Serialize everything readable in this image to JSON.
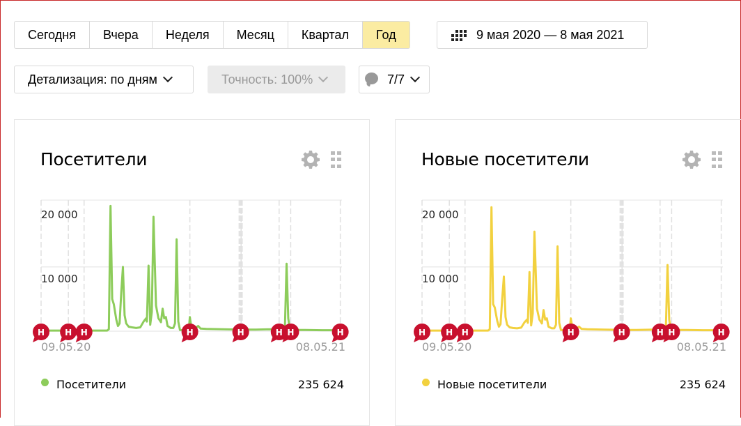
{
  "periods": [
    {
      "label": "Сегодня",
      "active": false
    },
    {
      "label": "Вчера",
      "active": false
    },
    {
      "label": "Неделя",
      "active": false
    },
    {
      "label": "Месяц",
      "active": false
    },
    {
      "label": "Квартал",
      "active": false
    },
    {
      "label": "Год",
      "active": true
    }
  ],
  "date_range": {
    "icon": "calendar-icon",
    "label": "9 мая 2020 — 8 мая 2021"
  },
  "controls": {
    "detail": "Детализация: по дням",
    "accuracy": "Точность: 100%",
    "notes": {
      "icon": "comment-bubble-icon",
      "label": "7/7"
    }
  },
  "colors": {
    "active_period": "#fbeca2",
    "visitors_series": "#8dcc5b",
    "new_visitors_series": "#f2d13f",
    "note_marker": "#c8102e"
  },
  "note_marker_label": "Н",
  "chart_data": [
    {
      "type": "line",
      "title": "Посетители",
      "xlabel": "",
      "ylabel": "",
      "x_tick_labels": [
        "09.05.20",
        "08.05.21"
      ],
      "y_tick_labels": [
        "10 000",
        "20 000"
      ],
      "ylim": [
        0,
        20000
      ],
      "xlim_days": [
        0,
        364
      ],
      "grid": true,
      "legend": {
        "label": "Посетители",
        "total": "235 624",
        "position": "bottom"
      },
      "series": [
        {
          "name": "Посетители",
          "color": "#8dcc5b",
          "points": [
            [
              0,
              100
            ],
            [
              80,
              100
            ],
            [
              82,
              300
            ],
            [
              84,
              19500
            ],
            [
              86,
              5000
            ],
            [
              88,
              4200
            ],
            [
              91,
              1800
            ],
            [
              93,
              800
            ],
            [
              95,
              1200
            ],
            [
              97,
              6000
            ],
            [
              99,
              10000
            ],
            [
              101,
              2500
            ],
            [
              103,
              1200
            ],
            [
              106,
              700
            ],
            [
              110,
              600
            ],
            [
              115,
              500
            ],
            [
              120,
              600
            ],
            [
              124,
              1500
            ],
            [
              127,
              2000
            ],
            [
              128,
              1500
            ],
            [
              130,
              10200
            ],
            [
              132,
              1000
            ],
            [
              134,
              3000
            ],
            [
              136,
              17800
            ],
            [
              139,
              4000
            ],
            [
              142,
              2000
            ],
            [
              145,
              1400
            ],
            [
              147,
              3500
            ],
            [
              149,
              2000
            ],
            [
              151,
              2200
            ],
            [
              153,
              800
            ],
            [
              157,
              500
            ],
            [
              160,
              500
            ],
            [
              162,
              1200
            ],
            [
              164,
              14300
            ],
            [
              166,
              1500
            ],
            [
              168,
              200
            ],
            [
              175,
              100
            ],
            [
              179,
              600
            ],
            [
              180,
              2200
            ],
            [
              182,
              400
            ],
            [
              186,
              400
            ],
            [
              190,
              800
            ],
            [
              193,
              400
            ],
            [
              200,
              350
            ],
            [
              220,
              300
            ],
            [
              240,
              250
            ],
            [
              260,
              250
            ],
            [
              280,
              300
            ],
            [
              293,
              250
            ],
            [
              295,
              500
            ],
            [
              297,
              10500
            ],
            [
              299,
              2000
            ],
            [
              301,
              200
            ],
            [
              320,
              200
            ],
            [
              340,
              150
            ],
            [
              364,
              150
            ]
          ]
        }
      ],
      "notes": [
        0,
        33,
        52,
        180,
        242,
        288,
        302,
        362
      ],
      "note_bands": [
        [
          239,
          244
        ]
      ]
    },
    {
      "type": "line",
      "title": "Новые посетители",
      "xlabel": "",
      "ylabel": "",
      "x_tick_labels": [
        "09.05.20",
        "08.05.21"
      ],
      "y_tick_labels": [
        "10 000",
        "20 000"
      ],
      "ylim": [
        0,
        20000
      ],
      "xlim_days": [
        0,
        364
      ],
      "grid": true,
      "legend": {
        "label": "Новые посетители",
        "total": "235 624",
        "position": "bottom"
      },
      "series": [
        {
          "name": "Новые посетители",
          "color": "#f2d13f",
          "points": [
            [
              0,
              100
            ],
            [
              80,
              100
            ],
            [
              82,
              300
            ],
            [
              84,
              19300
            ],
            [
              86,
              4200
            ],
            [
              88,
              3700
            ],
            [
              91,
              1600
            ],
            [
              93,
              700
            ],
            [
              95,
              1100
            ],
            [
              97,
              5000
            ],
            [
              99,
              8500
            ],
            [
              101,
              2200
            ],
            [
              103,
              1000
            ],
            [
              106,
              600
            ],
            [
              110,
              500
            ],
            [
              115,
              450
            ],
            [
              120,
              550
            ],
            [
              124,
              1400
            ],
            [
              127,
              1800
            ],
            [
              128,
              1300
            ],
            [
              130,
              9200
            ],
            [
              132,
              900
            ],
            [
              134,
              2800
            ],
            [
              136,
              15500
            ],
            [
              139,
              3500
            ],
            [
              142,
              1800
            ],
            [
              145,
              1200
            ],
            [
              147,
              3300
            ],
            [
              149,
              1800
            ],
            [
              151,
              2000
            ],
            [
              153,
              700
            ],
            [
              157,
              450
            ],
            [
              160,
              450
            ],
            [
              162,
              1000
            ],
            [
              164,
              13200
            ],
            [
              166,
              1300
            ],
            [
              168,
              200
            ],
            [
              175,
              100
            ],
            [
              179,
              500
            ],
            [
              180,
              2000
            ],
            [
              182,
              350
            ],
            [
              186,
              350
            ],
            [
              190,
              700
            ],
            [
              193,
              350
            ],
            [
              200,
              300
            ],
            [
              220,
              250
            ],
            [
              240,
              200
            ],
            [
              260,
              200
            ],
            [
              280,
              250
            ],
            [
              293,
              200
            ],
            [
              295,
              450
            ],
            [
              297,
              10300
            ],
            [
              299,
              1800
            ],
            [
              301,
              200
            ],
            [
              320,
              180
            ],
            [
              340,
              150
            ],
            [
              364,
              150
            ]
          ]
        }
      ],
      "notes": [
        0,
        33,
        52,
        180,
        242,
        288,
        302,
        362
      ],
      "note_bands": [
        [
          239,
          244
        ]
      ]
    }
  ]
}
